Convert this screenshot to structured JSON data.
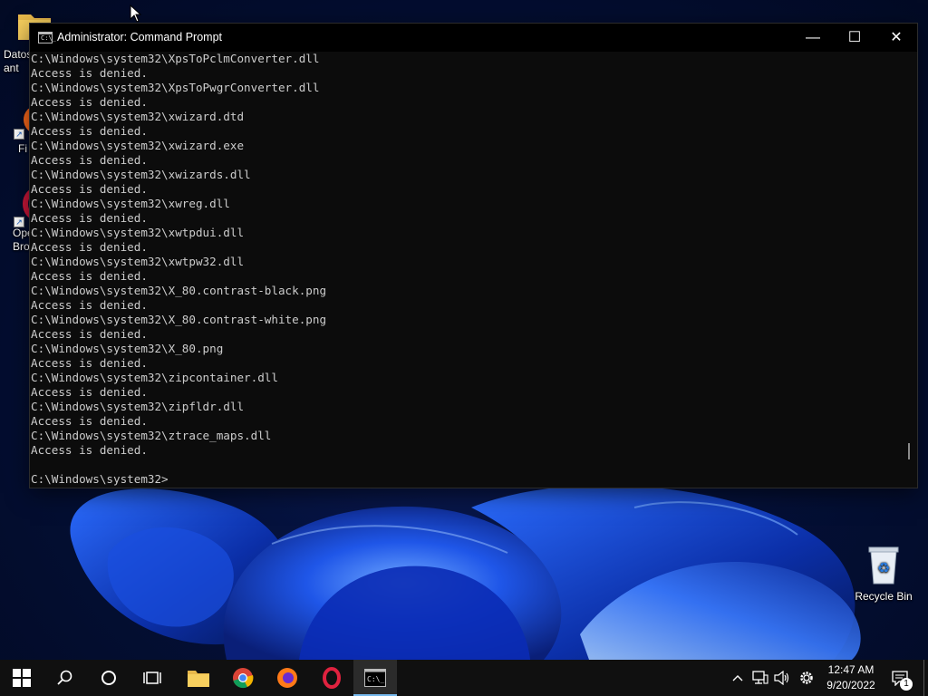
{
  "desktop": {
    "icons": [
      {
        "name": "icon-datos",
        "label": "Datos\nant"
      },
      {
        "name": "icon-firefox",
        "label": "Fi"
      },
      {
        "name": "icon-opera",
        "label": "Ope\nBro"
      },
      {
        "name": "icon-recycle",
        "label": "Recycle Bin"
      }
    ]
  },
  "window": {
    "title": "Administrator: Command Prompt",
    "title_icon_glyph": "C:\\_",
    "minimize_glyph": "—",
    "maximize_glyph": "☐",
    "close_glyph": "✕"
  },
  "console": {
    "lines": [
      "C:\\Windows\\system32\\XpsToPclmConverter.dll",
      "Access is denied.",
      "C:\\Windows\\system32\\XpsToPwgrConverter.dll",
      "Access is denied.",
      "C:\\Windows\\system32\\xwizard.dtd",
      "Access is denied.",
      "C:\\Windows\\system32\\xwizard.exe",
      "Access is denied.",
      "C:\\Windows\\system32\\xwizards.dll",
      "Access is denied.",
      "C:\\Windows\\system32\\xwreg.dll",
      "Access is denied.",
      "C:\\Windows\\system32\\xwtpdui.dll",
      "Access is denied.",
      "C:\\Windows\\system32\\xwtpw32.dll",
      "Access is denied.",
      "C:\\Windows\\system32\\X_80.contrast-black.png",
      "Access is denied.",
      "C:\\Windows\\system32\\X_80.contrast-white.png",
      "Access is denied.",
      "C:\\Windows\\system32\\X_80.png",
      "Access is denied.",
      "C:\\Windows\\system32\\zipcontainer.dll",
      "Access is denied.",
      "C:\\Windows\\system32\\zipfldr.dll",
      "Access is denied.",
      "C:\\Windows\\system32\\ztrace_maps.dll",
      "Access is denied.",
      "",
      "C:\\Windows\\system32>"
    ]
  },
  "taskbar": {
    "clock_time": "12:47 AM",
    "clock_date": "9/20/2022",
    "notification_count": "1",
    "pinned": [
      {
        "name": "start-button",
        "icon": "windows-logo-icon"
      },
      {
        "name": "search-button",
        "icon": "search-icon"
      },
      {
        "name": "cortana-button",
        "icon": "cortana-icon"
      },
      {
        "name": "task-view-button",
        "icon": "task-view-icon"
      },
      {
        "name": "file-explorer-button",
        "icon": "folder-icon"
      },
      {
        "name": "chrome-button",
        "icon": "chrome-icon"
      },
      {
        "name": "firefox-button",
        "icon": "firefox-icon"
      },
      {
        "name": "opera-button",
        "icon": "opera-icon"
      },
      {
        "name": "command-prompt-button",
        "icon": "terminal-icon",
        "active": true
      }
    ]
  },
  "colors": {
    "console_bg": "#0c0c0c",
    "console_fg": "#cccccc",
    "taskbar_bg": "#101010",
    "active_indicator": "#76b9ed"
  }
}
